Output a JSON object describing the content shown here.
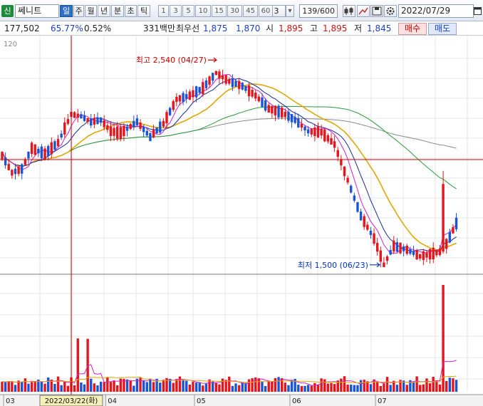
{
  "toolbar": {
    "logo": "신",
    "stock_name": "쎄니트",
    "periods": [
      {
        "label": "일",
        "active": true
      },
      {
        "label": "주",
        "active": false
      },
      {
        "label": "월",
        "active": false
      },
      {
        "label": "년",
        "active": false
      },
      {
        "label": "분",
        "active": false
      },
      {
        "label": "초",
        "active": false
      },
      {
        "label": "틱",
        "active": false
      }
    ],
    "intervals": [
      "1",
      "3",
      "5",
      "10",
      "15",
      "30",
      "45",
      "60"
    ],
    "interval_value": "3",
    "count": "139/600",
    "date": "2022/07/29",
    "icons": [
      "candle-settings-icon",
      "crosshair-line-icon",
      "save-icon",
      "gear-icon",
      "calendar-icon"
    ]
  },
  "info": {
    "volume": "177,502",
    "ratio1": "65.77%",
    "ratio2": "0.52%",
    "amount": "331백만",
    "best_ask_label": "최우선",
    "best_ask": "1,875",
    "best_bid": "1,870",
    "open_label": "시",
    "open": "1,895",
    "high_label": "고",
    "high": "1,895",
    "low_label": "저",
    "low": "1,845",
    "buy_label": "매수",
    "sell_label": "매도"
  },
  "chart_data": {
    "type": "candlestick",
    "top_label": "120",
    "x_labels": [
      "03",
      "04",
      "05",
      "06",
      "07"
    ],
    "cursor_date_label": "2022/03/22(화)",
    "annotations": [
      {
        "text": "최고 2,540 (04/27)",
        "color": "#cc0000"
      },
      {
        "text": "최저 1,500 (06/23)",
        "color": "#0033cc"
      }
    ],
    "price_range": [
      1450,
      2700
    ],
    "cursor_price": 2060,
    "colors": {
      "up": "#e8141c",
      "down": "#1a55d6",
      "ma5": "#d61ec8",
      "ma10": "#1a2a9c",
      "ma20": "#e0a800",
      "ma60": "#2a9a3c",
      "ma120": "#8a8a8a",
      "cursor": "#cc0000"
    },
    "grid": true
  }
}
